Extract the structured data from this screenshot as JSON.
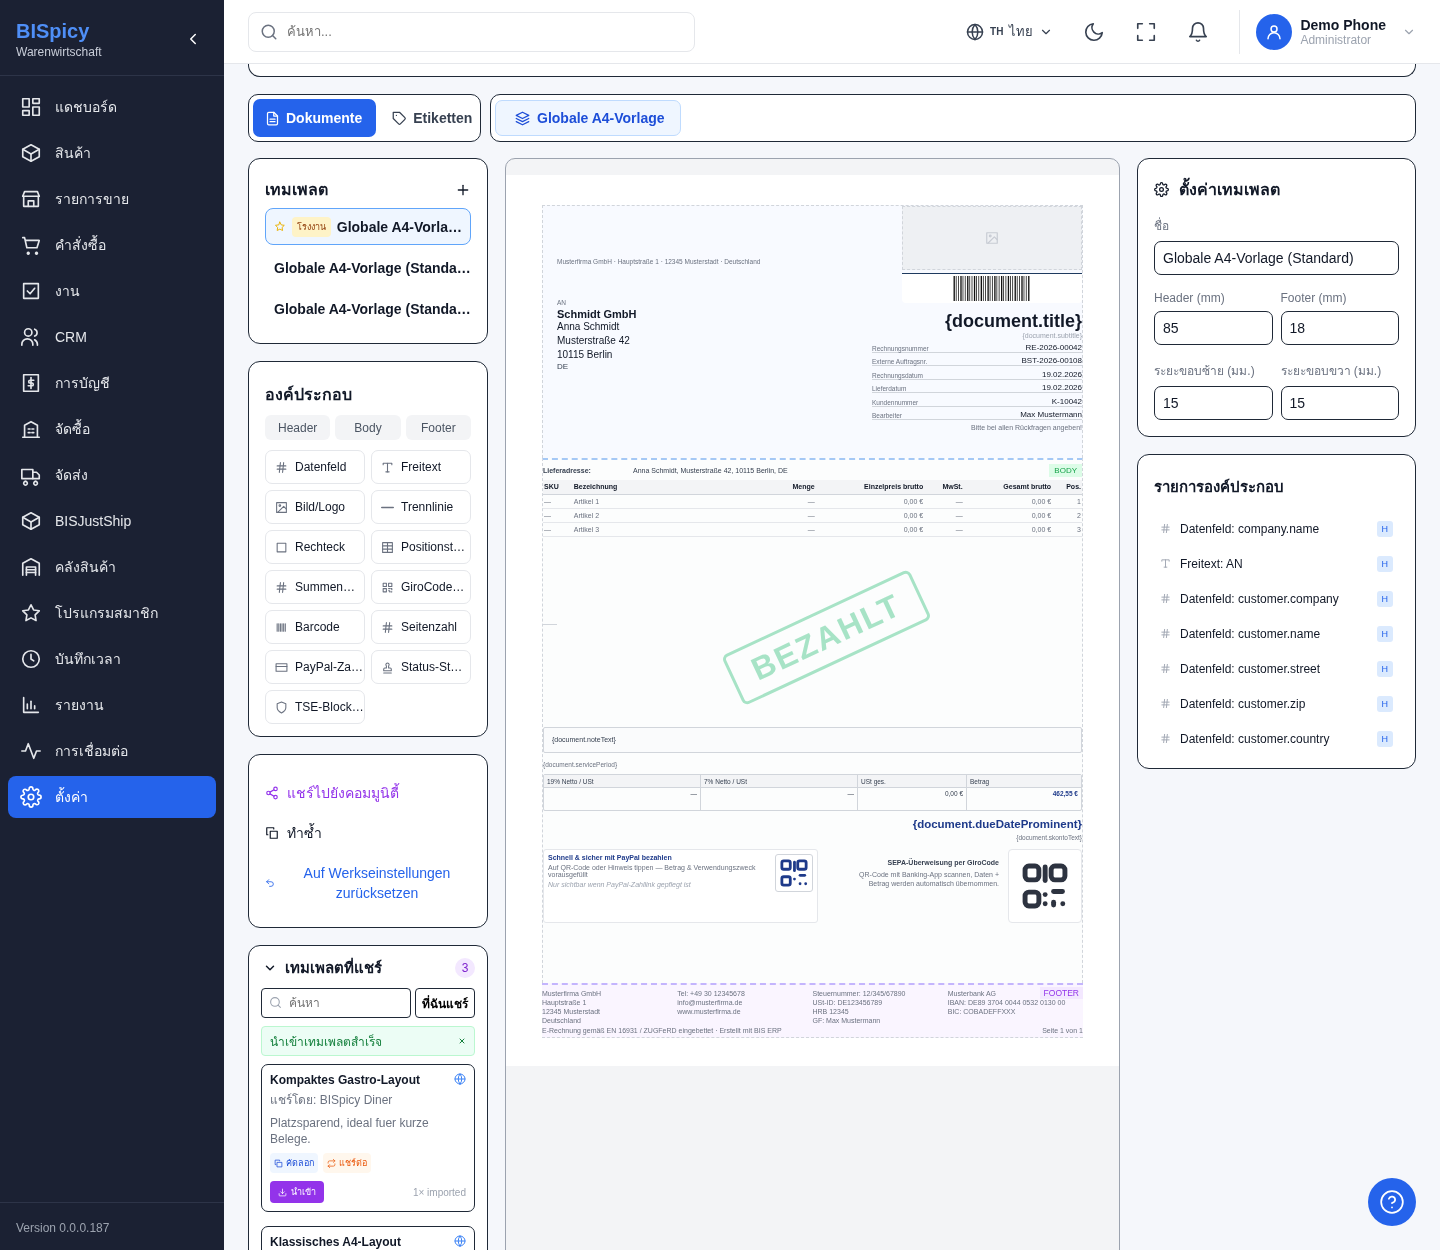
{
  "sidebar": {
    "brand": "BISpicy",
    "subtitle": "Warenwirtschaft",
    "items": [
      {
        "label": "แดชบอร์ด",
        "selected": false
      },
      {
        "label": "สินค้า",
        "selected": false
      },
      {
        "label": "รายการขาย",
        "selected": false
      },
      {
        "label": "คำสั่งซื้อ",
        "selected": false
      },
      {
        "label": "งาน",
        "selected": false
      },
      {
        "label": "CRM",
        "selected": false
      },
      {
        "label": "การบัญชี",
        "selected": false
      },
      {
        "label": "จัดซื้อ",
        "selected": false
      },
      {
        "label": "จัดส่ง",
        "selected": false
      },
      {
        "label": "BISJustShip",
        "selected": false
      },
      {
        "label": "คลังสินค้า",
        "selected": false
      },
      {
        "label": "โปรแกรมสมาชิก",
        "selected": false
      },
      {
        "label": "บันทึกเวลา",
        "selected": false
      },
      {
        "label": "รายงาน",
        "selected": false
      },
      {
        "label": "การเชื่อมต่อ",
        "selected": false
      },
      {
        "label": "ตั้งค่า",
        "selected": true
      }
    ],
    "version": "Version 0.0.0.187"
  },
  "topbar": {
    "search_placeholder": "ค้นหา...",
    "language_code": "TH",
    "language": "ไทย",
    "user_name": "Demo Phone",
    "user_role": "Administrator"
  },
  "doc_tabs": [
    {
      "label": "Dokumente",
      "selected": true
    },
    {
      "label": "Etiketten",
      "selected": false
    }
  ],
  "active_template_chip": "Globale A4-Vorlage",
  "templates": {
    "title": "เทมเพลต",
    "items": [
      {
        "name": "Globale A4-Vorla…",
        "badge": "โรงงาน",
        "starred": true,
        "selected": true
      },
      {
        "name": "Globale A4-Vorlage (Standa…",
        "starred": false,
        "selected": false
      },
      {
        "name": "Globale A4-Vorlage (Standa…",
        "starred": false,
        "selected": false
      }
    ]
  },
  "components": {
    "title": "องค์ประกอบ",
    "sections": [
      "Header",
      "Body",
      "Footer"
    ],
    "items": [
      "Datenfeld",
      "Freitext",
      "Bild/Logo",
      "Trennlinie",
      "Rechteck",
      "Positionst…",
      "Summen…",
      "GiroCode…",
      "Barcode",
      "Seitenzahl",
      "PayPal-Za…",
      "Status-St…",
      "TSE-Block…"
    ]
  },
  "actions": [
    {
      "label": "แชร์ไปยังคอมมูนิตี้",
      "kind": "share"
    },
    {
      "label": "ทำซ้ำ",
      "kind": "duplicate"
    },
    {
      "label": "Auf Werkseinstellungen zurücksetzen",
      "kind": "reset"
    }
  ],
  "shared": {
    "title": "เทมเพลตที่แชร์",
    "expanded": true,
    "count": "3",
    "search_placeholder": "ค้นหา",
    "filter_button": "ที่ฉันแชร์",
    "toast": "นำเข้าเทมเพลตสำเร็จ",
    "cards": [
      {
        "title": "Kompaktes Gastro-Layout",
        "shared_by": "แชร์โดย: BISpicy Diner",
        "description": "Platzsparend, ideal fuer kurze Belege.",
        "tags": [
          {
            "label": "คัดลอก",
            "kind": "copy"
          },
          {
            "label": "แชร์ต่อ",
            "kind": "reshare"
          }
        ],
        "import_button": "นำเข้า",
        "imports": "1× imported"
      },
      {
        "title": "Klassisches A4-Layout"
      }
    ]
  },
  "preview": {
    "sender_line": "Musterfirma GmbH · Hauptstraße 1 · 12345 Musterstadt · Deutschland",
    "recipient_label": "AN",
    "recipient_company": "Schmidt GmbH",
    "recipient_lines": [
      "Anna Schmidt",
      "Musterstraße 42",
      "10115 Berlin"
    ],
    "recipient_country": "DE",
    "title": "{document.title}",
    "subtitle": "{document.subtitle}",
    "meta": [
      {
        "label": "Rechnungsnummer",
        "value": "RE-2026-00042"
      },
      {
        "label": "Externe Auftragsnr.",
        "value": "BST-2026-00108"
      },
      {
        "label": "Rechnungsdatum",
        "value": "19.02.2026"
      },
      {
        "label": "Lieferdatum",
        "value": "19.02.2026"
      },
      {
        "label": "Kundennummer",
        "value": "K-10042"
      },
      {
        "label": "Bearbeiter",
        "value": "Max Mustermann"
      }
    ],
    "meta_note": "Bitte bei allen Rückfragen angeben!",
    "body_badge": "BODY",
    "delivery_label": "Lieferadresse:",
    "delivery_value": "Anna Schmidt, Musterstraße 42, 10115 Berlin, DE",
    "table": {
      "columns": [
        "SKU",
        "Bezeichnung",
        "Menge",
        "Einzelpreis brutto",
        "MwSt.",
        "Gesamt brutto",
        "Pos."
      ],
      "rows": [
        [
          "—",
          "Artikel 1",
          "—",
          "0,00 €",
          "—",
          "0,00 €",
          "1"
        ],
        [
          "—",
          "Artikel 2",
          "—",
          "0,00 €",
          "—",
          "0,00 €",
          "2"
        ],
        [
          "—",
          "Artikel 3",
          "—",
          "0,00 €",
          "—",
          "0,00 €",
          "3"
        ]
      ]
    },
    "stamp": "BEZAHLT",
    "note": "{document.noteText}",
    "service_period": "{document.servicePeriod}",
    "tax_table": {
      "columns": [
        "19% Netto / USt",
        "7% Netto / USt",
        "USt ges.",
        "Betrag"
      ],
      "cells": [
        "—",
        "—",
        "0,00 €",
        "462,55 €"
      ]
    },
    "due_date": "{document.dueDateProminent}",
    "skonto": "{document.skontoText}",
    "paypal": {
      "title": "Schnell & sicher mit PayPal bezahlen",
      "text": "Auf QR-Code oder Hinweis tippen — Betrag & Verwendungszweck vorausgefüllt",
      "hint": "Nur sichtbar wenn PayPal-Zahllink gepflegt ist"
    },
    "girocode": {
      "title": "SEPA-Überweisung per GiroCode",
      "text": "QR-Code mit Banking-App scannen, Daten + Betrag werden automatisch übernommen."
    },
    "footer_badge": "FOOTER",
    "footer_columns": [
      [
        "Musterfirma GmbH",
        "Hauptstraße 1",
        "12345 Musterstadt",
        "Deutschland"
      ],
      [
        "Tel: +49 30 12345678",
        "info@musterfirma.de",
        "www.musterfirma.de"
      ],
      [
        "Steuernummer: 12/345/67890",
        "USt-ID: DE123456789",
        "HRB 12345",
        "GF: Max Mustermann"
      ],
      [
        "Musterbank AG",
        "IBAN: DE89 3704 0044 0532 0130 00",
        "BIC: COBADEFFXXX"
      ]
    ],
    "footer_note": "E-Rechnung gemäß EN 16931 / ZUGFeRD eingebettet · Erstellt mit BIS ERP",
    "page_label": "Seite 1 von 1"
  },
  "settings": {
    "title": "ตั้งค่าเทมเพลต",
    "name_label": "ชื่อ",
    "name_value": "Globale A4-Vorlage (Standard)",
    "fields": [
      {
        "label": "Header (mm)",
        "value": "85"
      },
      {
        "label": "Footer (mm)",
        "value": "18"
      },
      {
        "label": "ระยะขอบซ้าย (มม.)",
        "value": "15"
      },
      {
        "label": "ระยะขอบขวา (มม.)",
        "value": "15"
      }
    ]
  },
  "element_list": {
    "title": "รายการองค์ประกอบ",
    "items": [
      {
        "label": "Datenfeld: company.name",
        "kind": "field",
        "section": "H"
      },
      {
        "label": "Freitext: AN",
        "kind": "text",
        "section": "H"
      },
      {
        "label": "Datenfeld: customer.company",
        "kind": "field",
        "section": "H"
      },
      {
        "label": "Datenfeld: customer.name",
        "kind": "field",
        "section": "H"
      },
      {
        "label": "Datenfeld: customer.street",
        "kind": "field",
        "section": "H"
      },
      {
        "label": "Datenfeld: customer.zip",
        "kind": "field",
        "section": "H"
      },
      {
        "label": "Datenfeld: customer.country",
        "kind": "field",
        "section": "H"
      }
    ]
  }
}
